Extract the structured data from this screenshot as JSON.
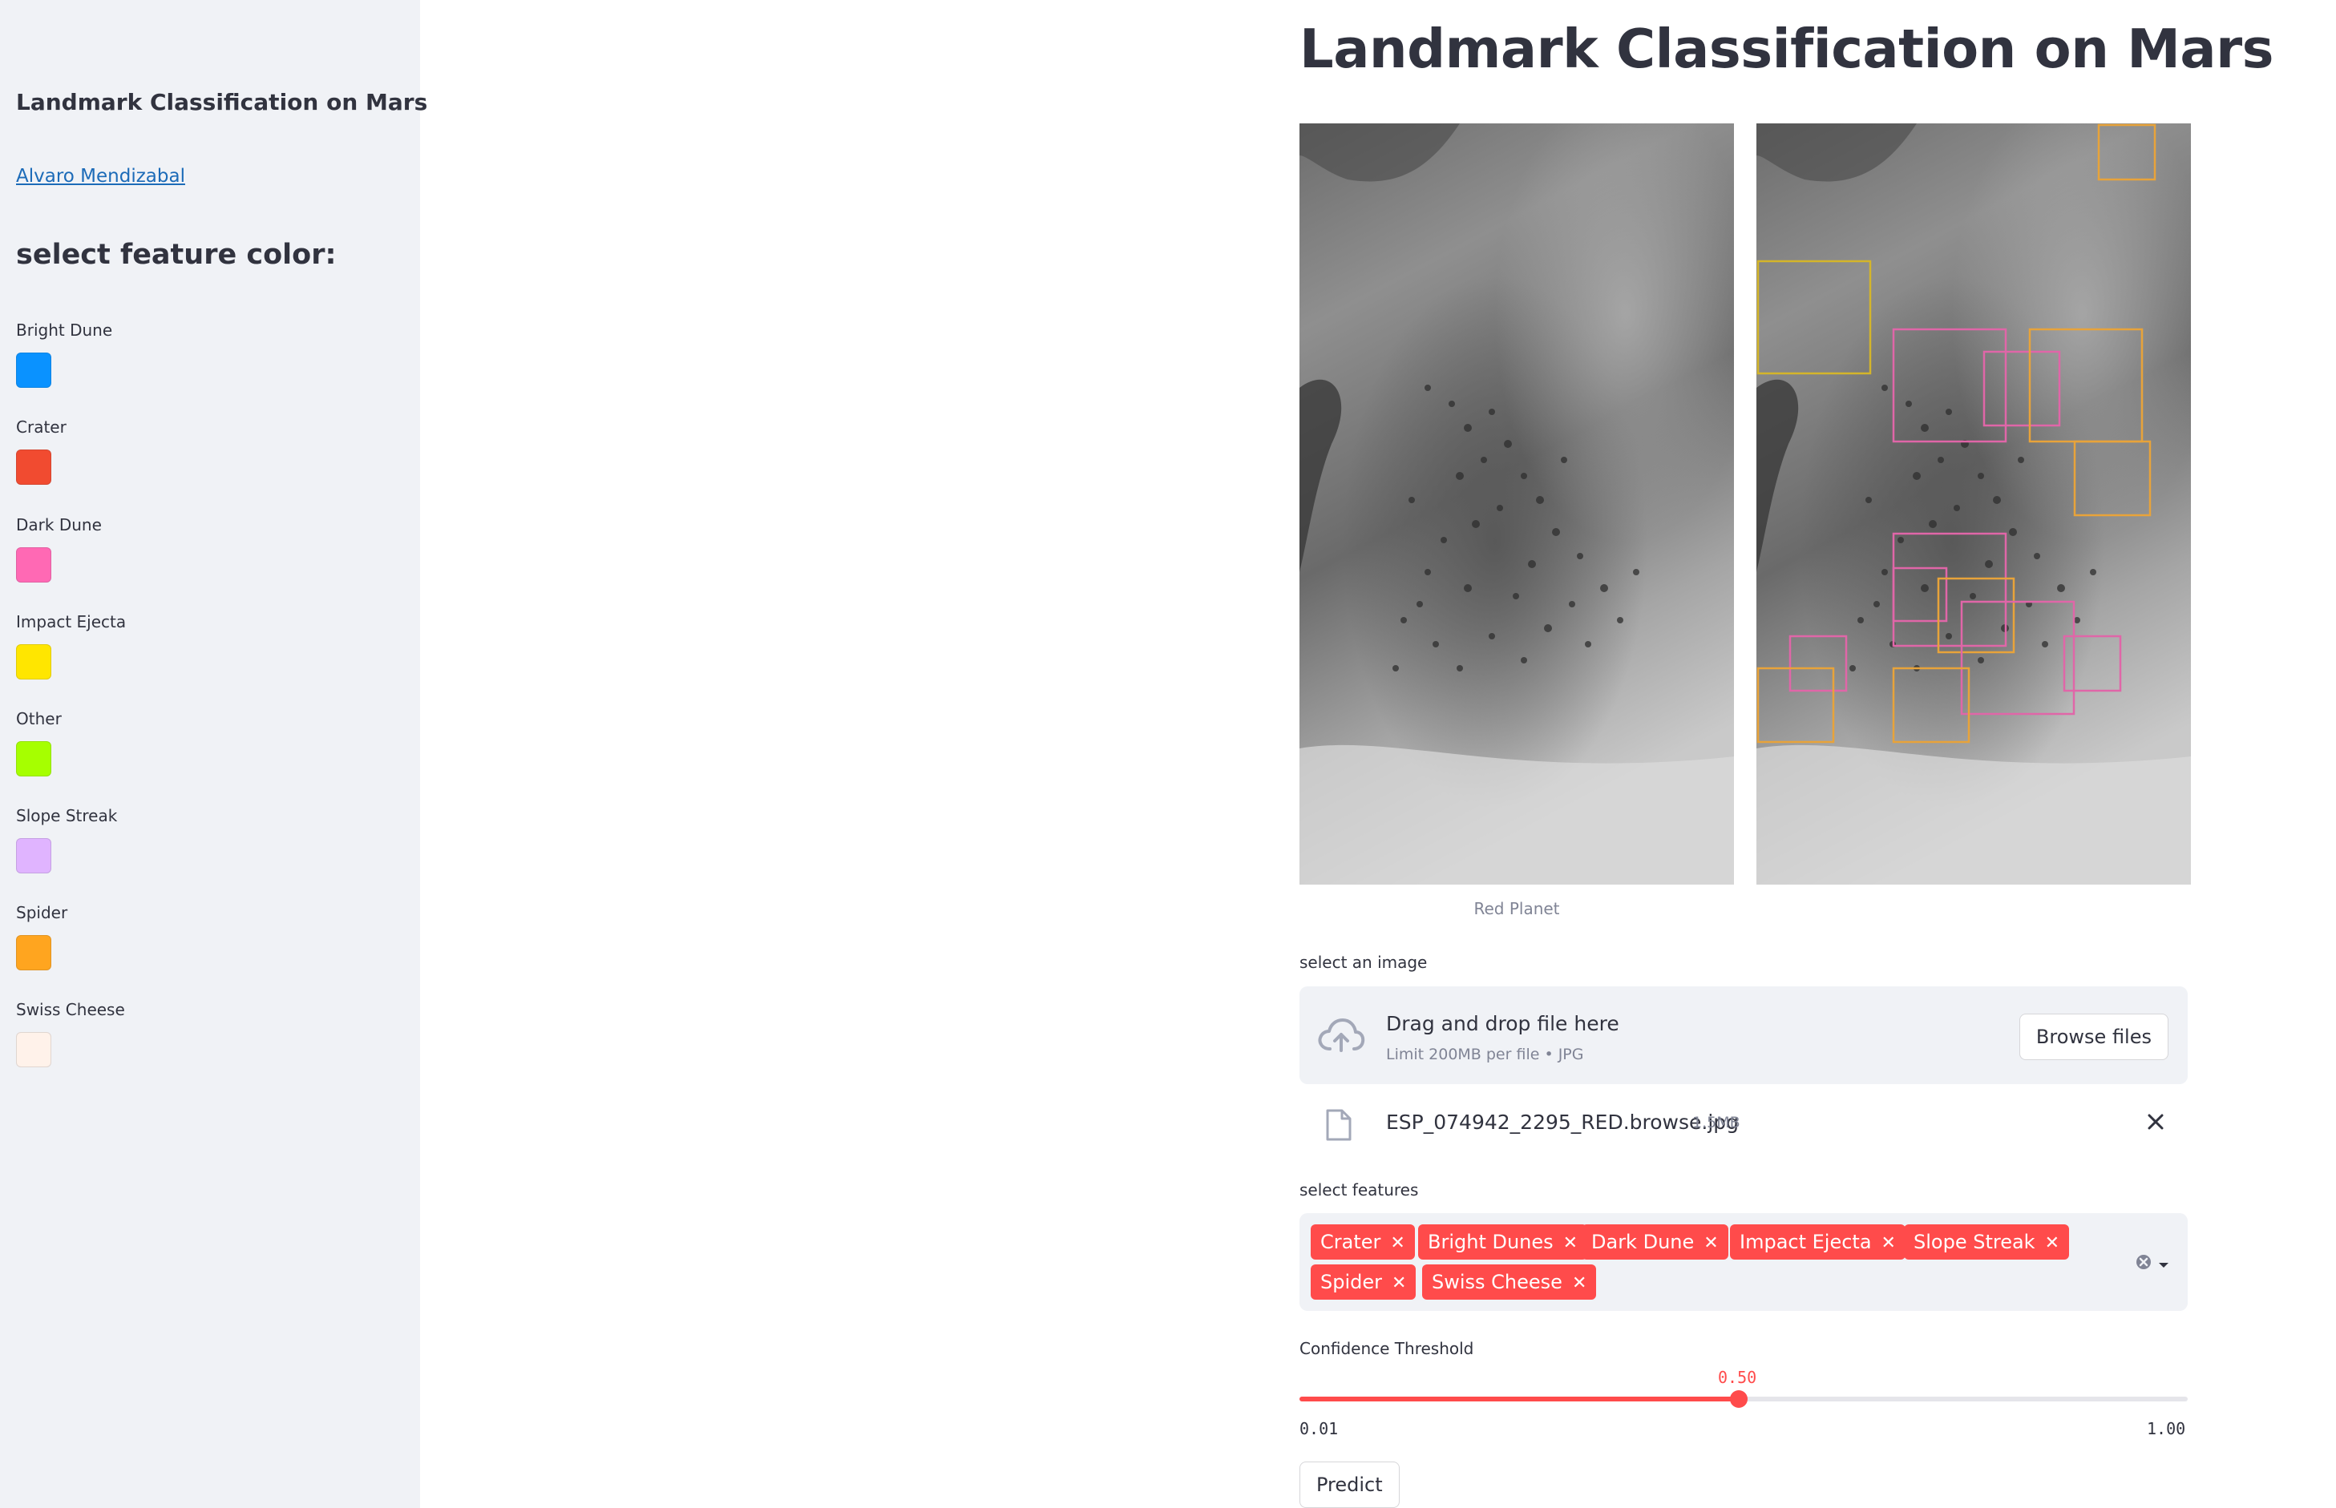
{
  "sidebar": {
    "title": "Landmark Classification on Mars",
    "author_link": "Alvaro Mendizabal",
    "heading": "select feature color:",
    "colors": [
      {
        "label": "Bright Dune",
        "color": "#0a92ff"
      },
      {
        "label": "Crater",
        "color": "#f14b30"
      },
      {
        "label": "Dark Dune",
        "color": "#ff69b4"
      },
      {
        "label": "Impact Ejecta",
        "color": "#ffe600"
      },
      {
        "label": "Other",
        "color": "#a6ff00"
      },
      {
        "label": "Slope Streak",
        "color": "#e0b4ff"
      },
      {
        "label": "Spider",
        "color": "#ffa51f"
      },
      {
        "label": "Swiss Cheese",
        "color": "#fff2ea"
      }
    ]
  },
  "main": {
    "title": "Landmark Classification on Mars",
    "image_caption": "Red Planet",
    "upload": {
      "label": "select an image",
      "drag_text": "Drag and drop file here",
      "limit_text": "Limit 200MB per file • JPG",
      "browse_label": "Browse files",
      "file_name": "ESP_074942_2295_RED.browse.jpg",
      "file_size": "1.5MB"
    },
    "features": {
      "label": "select features",
      "selected": [
        "Crater",
        "Bright Dunes",
        "Dark Dune",
        "Impact Ejecta",
        "Slope Streak",
        "Spider",
        "Swiss Cheese"
      ],
      "tag_color": "#ff4b4b"
    },
    "confidence": {
      "label": "Confidence Threshold",
      "value": "0.50",
      "value_fraction": 0.495,
      "min": "0.01",
      "max": "1.00",
      "accent": "#ff4b4b"
    },
    "predict_label": "Predict"
  }
}
